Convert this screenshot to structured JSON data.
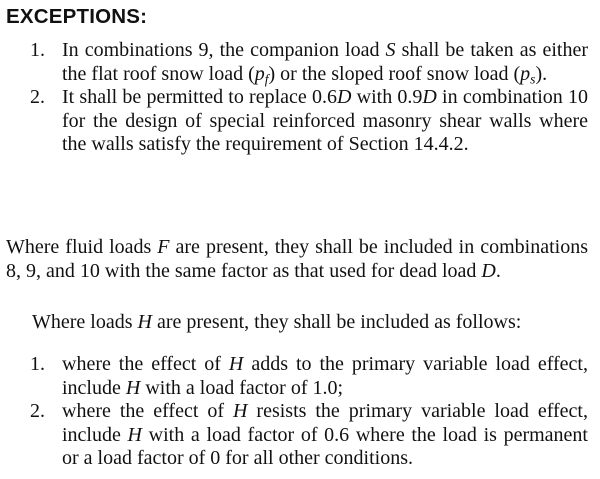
{
  "heading": "EXCEPTIONS:",
  "exceptions": [
    {
      "num": "1.",
      "parts": [
        "In combinations 9, the companion load ",
        "S",
        " shall be taken as either the flat roof snow load (",
        "p",
        "f",
        ") or the sloped roof snow load (",
        "p",
        "s",
        ")."
      ]
    },
    {
      "num": "2.",
      "parts": [
        "It shall be permitted to replace 0.6",
        "D",
        " with 0.9",
        "D",
        " in combination 10 for the design of special reinforced masonry shear walls where the walls satisfy the requirement of Section 14.4.2."
      ]
    }
  ],
  "paragraph1": {
    "parts": [
      "Where fluid loads ",
      "F",
      " are present, they shall be included in combinations 8, 9, and 10 with the same factor as that used for dead load ",
      "D",
      "."
    ]
  },
  "paragraph2": {
    "parts": [
      "Where loads ",
      "H",
      " are present, they shall be included as follows:"
    ]
  },
  "h_items": [
    {
      "num": "1.",
      "parts": [
        "where the effect of ",
        "H",
        " adds to the primary variable load effect, include ",
        "H",
        " with a load factor of 1.0;"
      ]
    },
    {
      "num": "2.",
      "parts": [
        "where the effect of ",
        "H",
        " resists the primary variable load effect, include ",
        "H",
        " with a load factor of 0.6 where the load is permanent or a load factor of 0 for all other conditions."
      ]
    }
  ]
}
